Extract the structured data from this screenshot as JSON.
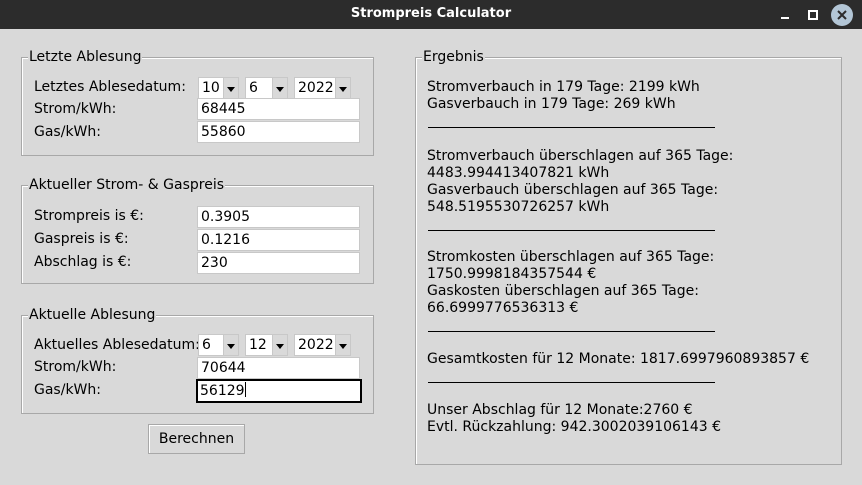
{
  "window": {
    "title": "Strompreis Calculator"
  },
  "last_reading": {
    "legend": "Letzte Ablesung",
    "date_label": "Letztes Ablesedatum:",
    "day": "10",
    "month": "6",
    "year": "2022",
    "strom_label": "Strom/kWh:",
    "strom_value": "68445",
    "gas_label": "Gas/kWh:",
    "gas_value": "55860"
  },
  "prices": {
    "legend": "Aktueller Strom- & Gaspreis",
    "strom_label": "Strompreis is €:",
    "strom_value": "0.3905",
    "gas_label": "Gaspreis is €:",
    "gas_value": "0.1216",
    "abschlag_label": "Abschlag is €:",
    "abschlag_value": "230"
  },
  "current_reading": {
    "legend": "Aktuelle Ablesung",
    "date_label": "Aktuelles Ablesedatum:",
    "day": "6",
    "month": "12",
    "year": "2022",
    "strom_label": "Strom/kWh:",
    "strom_value": "70644",
    "gas_label": "Gas/kWh:",
    "gas_value": "56129"
  },
  "calculate_button": "Berechnen",
  "result": {
    "legend": "Ergebnis",
    "lines": [
      "Stromverbauch in 179 Tage: 2199 kWh",
      "Gasverbauch in 179 Tage: 269 kWh",
      "Stromverbauch überschlagen auf 365 Tage:",
      "4483.994413407821 kWh",
      "Gasverbauch überschlagen auf 365 Tage:",
      "548.5195530726257 kWh",
      "Stromkosten überschlagen auf 365 Tage:",
      "1750.9998184357544 €",
      "Gaskosten überschlagen auf 365 Tage:",
      "66.6999776536313 €",
      "Gesamtkosten für 12 Monate: 1817.6997960893857 €",
      "Unser Abschlag für 12 Monate:2760 €",
      "Evtl. Rückzahlung: 942.3002039106143 €"
    ]
  }
}
